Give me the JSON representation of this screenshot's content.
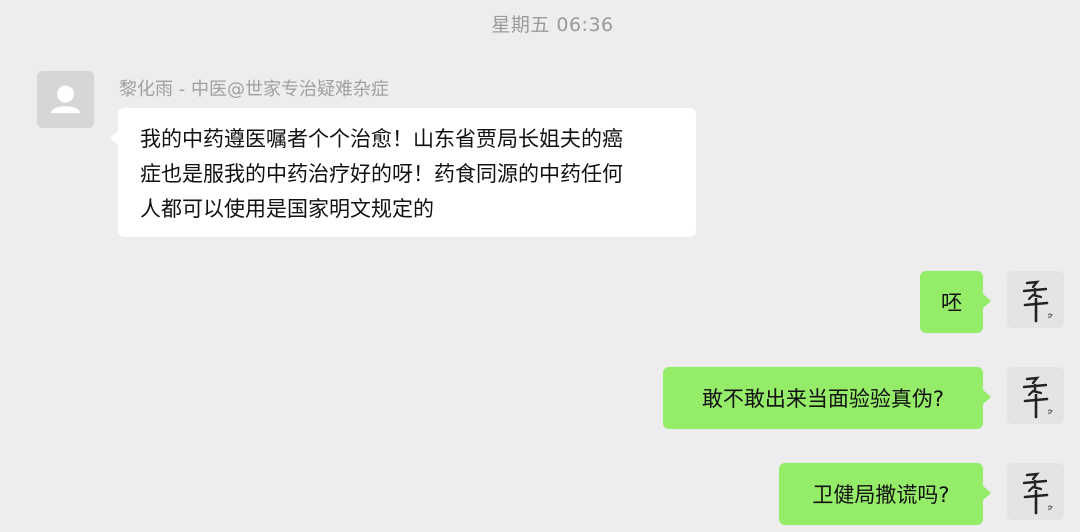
{
  "timestamp": "星期五 06:36",
  "incoming": {
    "sender": "黎化雨 - 中医@世家专治疑难杂症",
    "lines": [
      "我的中药遵医嘱者个个治愈！山东省贾局长姐夫的癌",
      "症也是服我的中药治疗好的呀！药食同源的中药任何",
      "人都可以使用是国家明文规定的"
    ]
  },
  "outgoing": [
    {
      "text": "呸"
    },
    {
      "text": "敢不敢出来当面验验真伪?"
    },
    {
      "text": "卫健局撒谎吗?"
    }
  ],
  "colors": {
    "background": "#ededed",
    "incoming_bubble": "#ffffff",
    "outgoing_bubble": "#95ec69",
    "meta_text": "#9a9a9a"
  },
  "icons": {
    "incoming_avatar": "default-person-icon",
    "outgoing_avatar": "calligraphy-avatar"
  }
}
